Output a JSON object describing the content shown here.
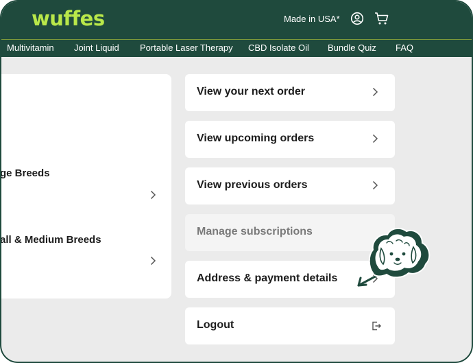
{
  "brand": {
    "logo": "wuffes"
  },
  "header": {
    "region_label": "Made in USA*",
    "account_icon": "user-circle-icon",
    "cart_icon": "cart-icon"
  },
  "nav": {
    "items": [
      "Multivitamin",
      "Joint Liquid",
      "Portable Laser Therapy",
      "CBD Isolate Oil",
      "Bundle Quiz",
      "FAQ"
    ]
  },
  "breeds": {
    "large": "ge Breeds",
    "small_medium": "all & Medium Breeds"
  },
  "menu": {
    "items": [
      {
        "label": "View your next order",
        "state": "enabled"
      },
      {
        "label": "View upcoming orders",
        "state": "enabled"
      },
      {
        "label": "View previous orders",
        "state": "enabled"
      },
      {
        "label": "Manage subscriptions",
        "state": "selected-disabled"
      },
      {
        "label": "Address & payment details",
        "state": "enabled"
      },
      {
        "label": "Logout",
        "state": "enabled"
      }
    ]
  },
  "colors": {
    "brand_dark": "#1f4a3d",
    "brand_lime": "#b9e84a",
    "page_bg": "#ebebeb"
  }
}
